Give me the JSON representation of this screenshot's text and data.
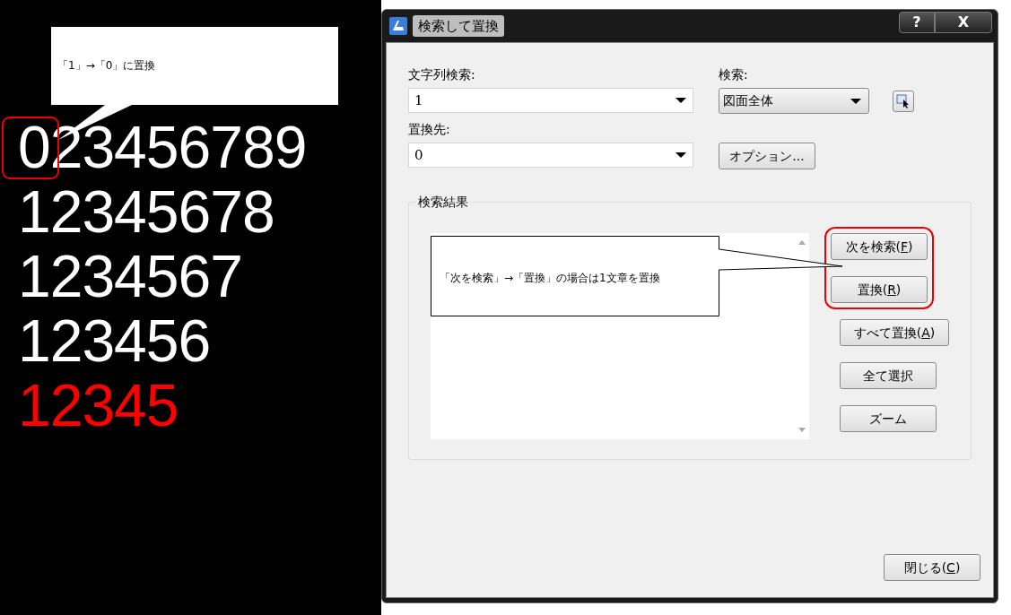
{
  "canvas": {
    "callout": {
      "text": "「1」→「0」に置換"
    },
    "rows": [
      {
        "text": "023456789",
        "color": "#ffffff",
        "highlight_first": true
      },
      {
        "text": "12345678",
        "color": "#ffffff",
        "highlight_first": false
      },
      {
        "text": "1234567",
        "color": "#ffffff",
        "highlight_first": false
      },
      {
        "text": "123456",
        "color": "#ffffff",
        "highlight_first": false
      },
      {
        "text": "12345",
        "color": "#ff0000",
        "highlight_first": false
      }
    ]
  },
  "window": {
    "title": "検索して置換",
    "help": "?",
    "close": "X"
  },
  "find": {
    "label": "文字列検索:",
    "value": "1"
  },
  "scope": {
    "label": "検索:",
    "value": "図面全体"
  },
  "replace": {
    "label": "置換先:",
    "value": "0"
  },
  "options_button": "オプション...",
  "results": {
    "title": "検索結果",
    "callout": {
      "text": "「次を検索」→「置換」の場合は1文章を置換"
    },
    "buttons": [
      {
        "label": "次を検索(",
        "key": "F",
        "suffix": ")",
        "highlighted": true
      },
      {
        "label": "置換(",
        "key": "R",
        "suffix": ")",
        "highlighted": true
      },
      {
        "label": "すべて置換(",
        "key": "A",
        "suffix": ")",
        "highlighted": false
      },
      {
        "label": "全て選択",
        "highlighted": false
      },
      {
        "label": "ズーム",
        "highlighted": false
      }
    ]
  },
  "close_button": {
    "label": "閉じる(",
    "key": "C",
    "suffix": ")"
  }
}
